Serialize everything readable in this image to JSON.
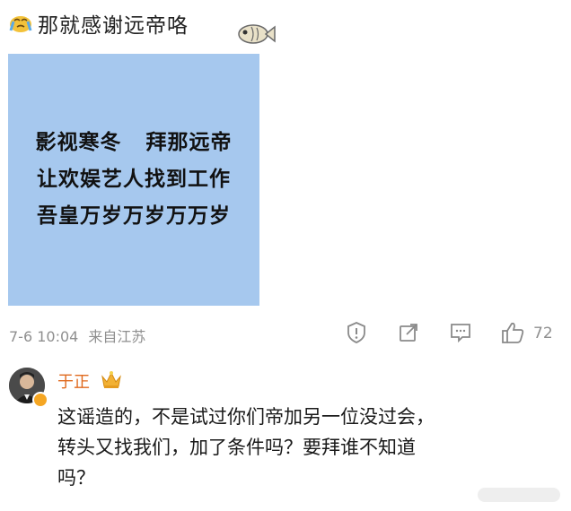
{
  "post": {
    "emoji": "crying-face-emoji",
    "text": "那就感谢远帝咯",
    "fish_emoji": "fish-emoji",
    "image_lines": [
      "影视寒冬   拜那远帝",
      "让欢娱艺人找到工作",
      "吾皇万岁万岁万万岁"
    ],
    "meta": {
      "time": "7-6 10:04",
      "source": "来自江苏"
    },
    "actions": {
      "like_count": "72"
    },
    "colors": {
      "image_bg": "#a6c8ee",
      "meta_gray": "#8f8f8f",
      "name_orange": "#e06a1e"
    }
  },
  "comment": {
    "author": "于正",
    "badge": "crown-icon",
    "lines": [
      "这谣造的，不是试过你们帝加另一位没过会，",
      "转头又找我们，加了条件吗？要拜谁不知道",
      "吗？"
    ]
  }
}
